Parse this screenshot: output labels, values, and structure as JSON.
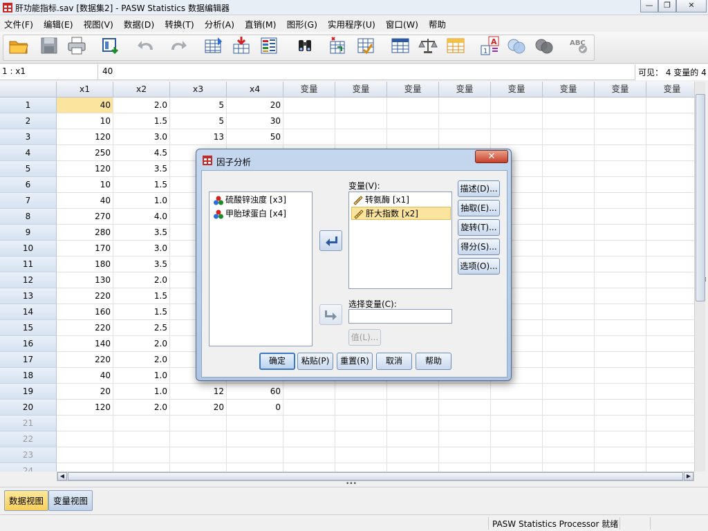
{
  "window": {
    "title": "肝功能指标.sav [数据集2] - PASW Statistics 数据编辑器",
    "minimize": "—",
    "restore": "❐",
    "close": "✕"
  },
  "menu": [
    "文件(F)",
    "编辑(E)",
    "视图(V)",
    "数据(D)",
    "转换(T)",
    "分析(A)",
    "直销(M)",
    "图形(G)",
    "实用程序(U)",
    "窗口(W)",
    "帮助"
  ],
  "cellbar": {
    "ref": "1 : x1",
    "value": "40",
    "visible": "可见： 4 变量的 4"
  },
  "grid": {
    "columns": [
      "x1",
      "x2",
      "x3",
      "x4",
      "变量",
      "变量",
      "变量",
      "变量",
      "变量",
      "变量",
      "变量",
      "变量"
    ],
    "rows": [
      {
        "n": "1",
        "v": [
          "40",
          "2.0",
          "5",
          "20"
        ]
      },
      {
        "n": "2",
        "v": [
          "10",
          "1.5",
          "5",
          "30"
        ]
      },
      {
        "n": "3",
        "v": [
          "120",
          "3.0",
          "13",
          "50"
        ]
      },
      {
        "n": "4",
        "v": [
          "250",
          "4.5",
          "",
          ""
        ]
      },
      {
        "n": "5",
        "v": [
          "120",
          "3.5",
          "",
          ""
        ]
      },
      {
        "n": "6",
        "v": [
          "10",
          "1.5",
          "",
          ""
        ]
      },
      {
        "n": "7",
        "v": [
          "40",
          "1.0",
          "",
          ""
        ]
      },
      {
        "n": "8",
        "v": [
          "270",
          "4.0",
          "",
          ""
        ]
      },
      {
        "n": "9",
        "v": [
          "280",
          "3.5",
          "",
          ""
        ]
      },
      {
        "n": "10",
        "v": [
          "170",
          "3.0",
          "",
          ""
        ]
      },
      {
        "n": "11",
        "v": [
          "180",
          "3.5",
          "",
          ""
        ]
      },
      {
        "n": "12",
        "v": [
          "130",
          "2.0",
          "",
          ""
        ]
      },
      {
        "n": "13",
        "v": [
          "220",
          "1.5",
          "",
          ""
        ]
      },
      {
        "n": "14",
        "v": [
          "160",
          "1.5",
          "",
          ""
        ]
      },
      {
        "n": "15",
        "v": [
          "220",
          "2.5",
          "",
          ""
        ]
      },
      {
        "n": "16",
        "v": [
          "140",
          "2.0",
          "",
          ""
        ]
      },
      {
        "n": "17",
        "v": [
          "220",
          "2.0",
          "",
          ""
        ]
      },
      {
        "n": "18",
        "v": [
          "40",
          "1.0",
          "",
          ""
        ]
      },
      {
        "n": "19",
        "v": [
          "20",
          "1.0",
          "12",
          "60"
        ]
      },
      {
        "n": "20",
        "v": [
          "120",
          "2.0",
          "20",
          "0"
        ]
      },
      {
        "n": "21",
        "v": [
          "",
          "",
          "",
          ""
        ]
      },
      {
        "n": "22",
        "v": [
          "",
          "",
          "",
          ""
        ]
      },
      {
        "n": "23",
        "v": [
          "",
          "",
          "",
          ""
        ]
      },
      {
        "n": "24",
        "v": [
          "",
          "",
          "",
          ""
        ]
      }
    ]
  },
  "tabs": {
    "data_view": "数据视图",
    "variable_view": "变量视图"
  },
  "status": "PASW Statistics Processor 就绪",
  "dialog": {
    "title": "因子分析",
    "close": "✕",
    "source_vars": [
      "硫酸锌浊度 [x3]",
      "甲胎球蛋白 [x4]"
    ],
    "variables_label": "变量(V):",
    "target_vars": [
      "转氨酶 [x1]",
      "肝大指数 [x2]"
    ],
    "selection_label": "选择变量(C):",
    "value_button": "值(L)...",
    "side_buttons": [
      "描述(D)...",
      "抽取(E)...",
      "旋转(T)...",
      "得分(S)...",
      "选项(O)..."
    ],
    "ok": "确定",
    "paste": "粘贴(P)",
    "reset": "重置(R)",
    "cancel": "取消",
    "help": "帮助"
  },
  "colors": {
    "selection": "#fbe49e",
    "header": "#dbe3ee",
    "accent": "#3c78c6"
  }
}
